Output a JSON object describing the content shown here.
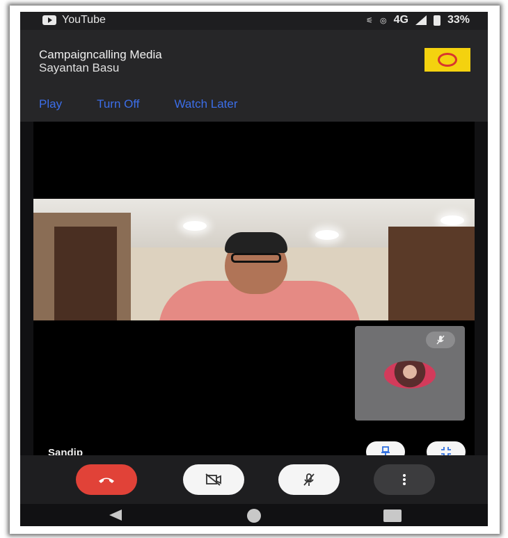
{
  "status_bar": {
    "app_name": "YouTube",
    "network_icon": "lte-call-icon",
    "hotspot_icon": "hotspot-icon",
    "network": "4G",
    "signal_icon": "signal-icon",
    "battery_icon": "battery-icon",
    "battery": "33%"
  },
  "notification": {
    "title": "Campaigncalling Media",
    "subtitle": "Sayantan Basu",
    "actions": [
      "Play",
      "Turn Off",
      "Watch Later"
    ],
    "logo_icon": "campaigncalling-logo"
  },
  "call": {
    "participant_name": "Sandip",
    "pip_icon": "mic-off-icon",
    "pin_icon": "pin-icon",
    "minimize_icon": "minimize-icon"
  },
  "controls": {
    "icons": [
      "end-call-icon",
      "video-off-icon",
      "mic-off-icon",
      "more-vertical-icon"
    ]
  },
  "navbar": {
    "icons": [
      "back-icon",
      "home-icon",
      "recents-icon"
    ]
  },
  "colors": {
    "action_link": "#3c6ee8",
    "end_call": "#e14238",
    "logo_bg": "#f4d20f"
  }
}
